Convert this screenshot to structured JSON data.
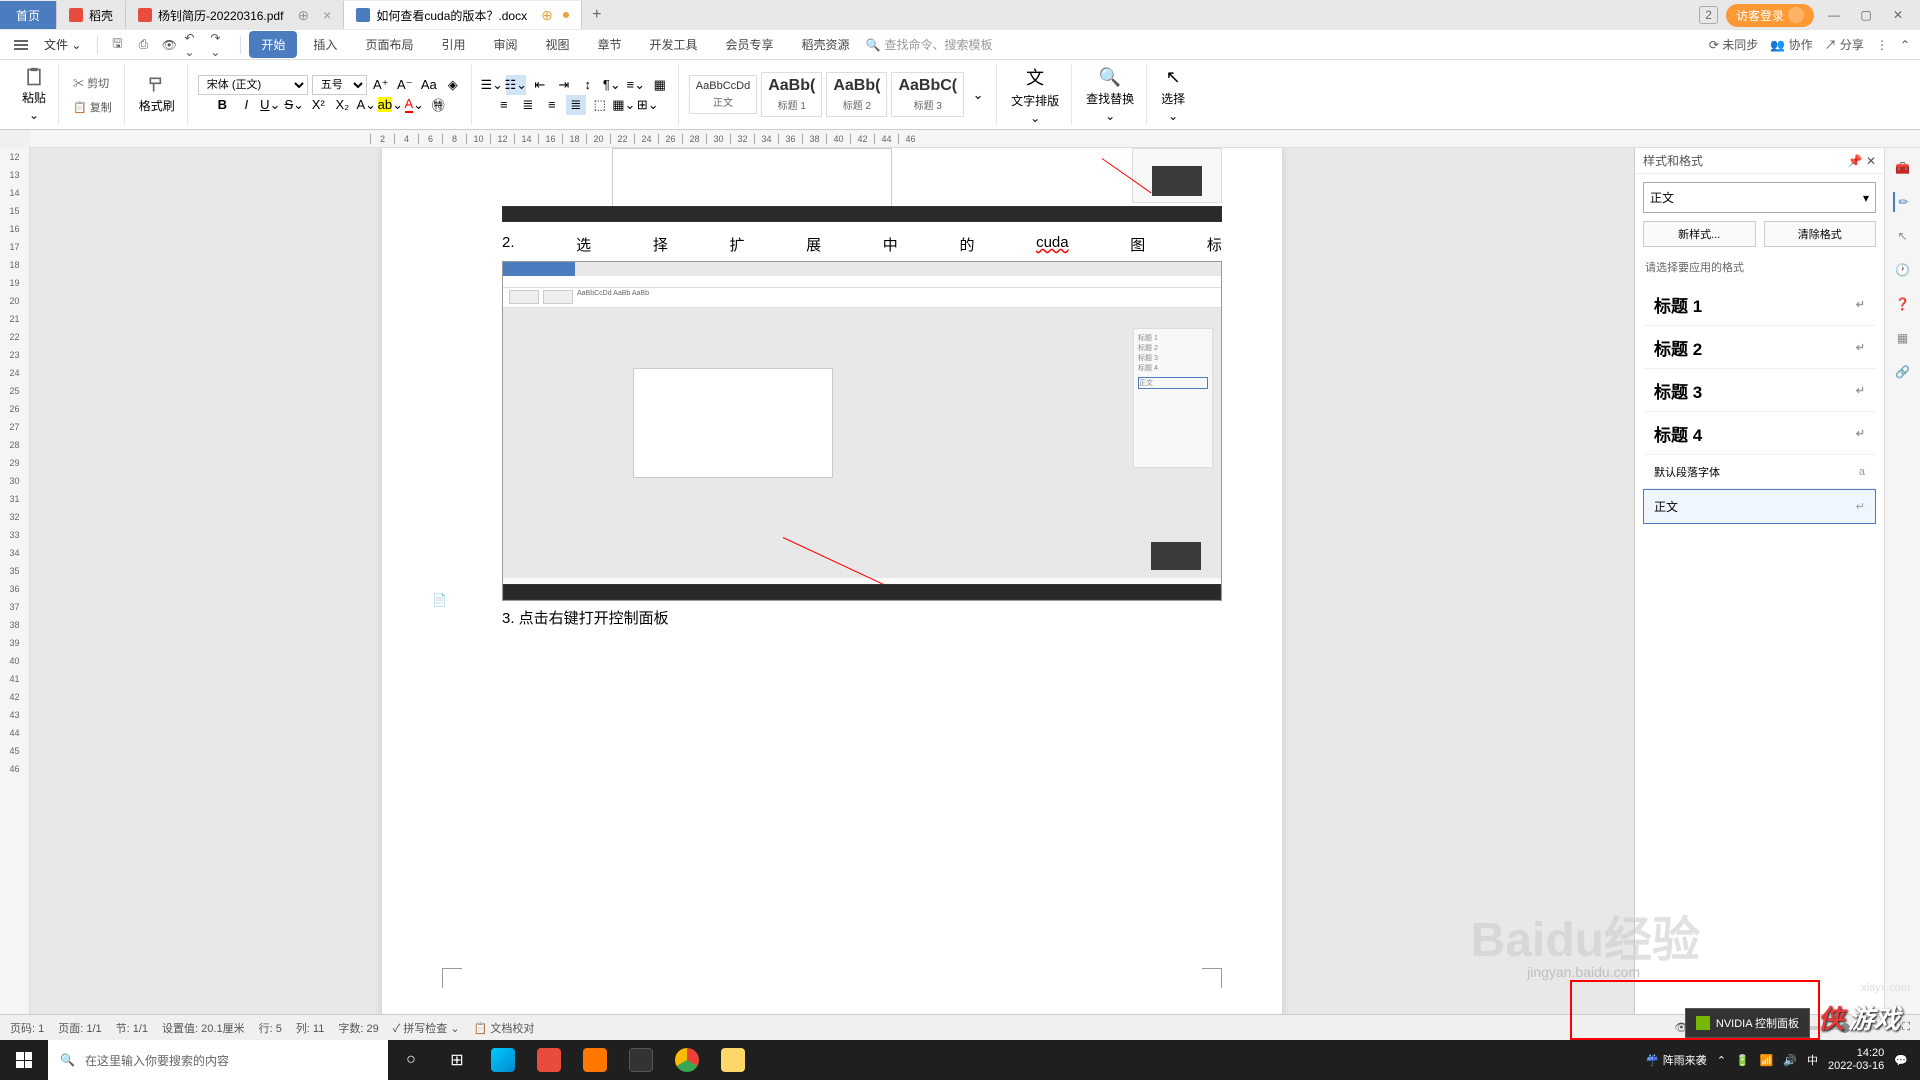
{
  "titlebar": {
    "home": "首页",
    "tab1": "稻壳",
    "tab2": "杨钊简历-20220316.pdf",
    "tab3": "如何查看cuda的版本？.docx",
    "login": "访客登录",
    "badge": "2"
  },
  "menubar": {
    "file": "文件",
    "tabs": [
      "开始",
      "插入",
      "页面布局",
      "引用",
      "审阅",
      "视图",
      "章节",
      "开发工具",
      "会员专享",
      "稻壳资源"
    ],
    "search_placeholder": "查找命令、搜索模板",
    "unsync": "未同步",
    "coop": "协作",
    "share": "分享"
  },
  "ribbon": {
    "paste": "粘贴",
    "cut": "剪切",
    "copy": "复制",
    "format_painter": "格式刷",
    "font_family": "宋体 (正文)",
    "font_size": "五号",
    "styles": {
      "body_sample": "AaBbCcDd",
      "body_name": "正文",
      "h1_sample": "AaBb(",
      "h1_name": "标题 1",
      "h2_sample": "AaBb(",
      "h2_name": "标题 2",
      "h3_sample": "AaBbC(",
      "h3_name": "标题 3"
    },
    "text_layout": "文字排版",
    "find_replace": "查找替换",
    "select": "选择"
  },
  "ruler_h": [
    "2",
    "4",
    "6",
    "8",
    "10",
    "12",
    "14",
    "16",
    "18",
    "20",
    "22",
    "24",
    "26",
    "28",
    "30",
    "32",
    "34",
    "36",
    "38",
    "40",
    "42",
    "44",
    "46"
  ],
  "ruler_v": [
    "12",
    "13",
    "14",
    "15",
    "16",
    "17",
    "18",
    "19",
    "20",
    "21",
    "22",
    "23",
    "24",
    "25",
    "26",
    "27",
    "28",
    "29",
    "30",
    "31",
    "32",
    "33",
    "34",
    "35",
    "36",
    "37",
    "38",
    "39",
    "40",
    "41",
    "42",
    "43",
    "44",
    "45",
    "46"
  ],
  "document": {
    "line2_words": [
      "2.",
      "选",
      "择",
      "扩",
      "展",
      "中",
      "的",
      "cuda",
      "图",
      "标"
    ],
    "line3": "3.  点击右键打开控制面板"
  },
  "styles_panel": {
    "title": "样式和格式",
    "current": "正文",
    "new_style": "新样式...",
    "clear": "清除格式",
    "prompt": "请选择要应用的格式",
    "items": [
      "标题 1",
      "标题 2",
      "标题 3",
      "标题 4"
    ],
    "default_font": "默认段落字体",
    "body": "正文"
  },
  "statusbar": {
    "page_num": "页码: 1",
    "page": "页面: 1/1",
    "section": "节: 1/1",
    "setting": "设置值: 20.1厘米",
    "row": "行: 5",
    "col": "列: 11",
    "words": "字数: 29",
    "spellcheck": "拼写检查",
    "doc_check": "文档校对"
  },
  "taskbar": {
    "search_placeholder": "在这里输入你要搜索的内容",
    "weather": "阵雨来袭",
    "time": "14:20",
    "date": "2022-03-16"
  },
  "popup": {
    "nvidia": "NVIDIA 控制面板"
  },
  "watermark": {
    "main": "Baidu经验",
    "sub": "jingyan.baidu.com",
    "logo1": "侠",
    "logo2": "游戏",
    "xiayx": "xiayx.com"
  }
}
